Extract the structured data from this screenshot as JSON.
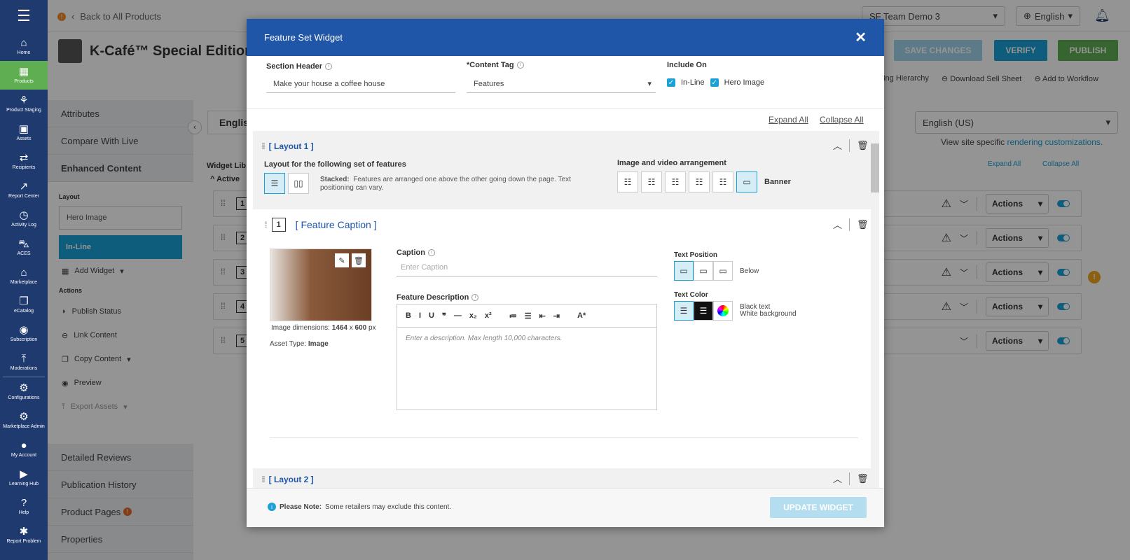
{
  "nav": {
    "items": [
      {
        "icon": "home-icon",
        "glyph": "⌂",
        "label": "Home"
      },
      {
        "icon": "products-icon",
        "glyph": "▦",
        "label": "Products"
      },
      {
        "icon": "product-staging-icon",
        "glyph": "⚘",
        "label": "Product Staging"
      },
      {
        "icon": "assets-icon",
        "glyph": "▣",
        "label": "Assets"
      },
      {
        "icon": "recipients-icon",
        "glyph": "⇄",
        "label": "Recipients"
      },
      {
        "icon": "report-center-icon",
        "glyph": "↗",
        "label": "Report Center"
      },
      {
        "icon": "activity-log-icon",
        "glyph": "◷",
        "label": "Activity Log"
      },
      {
        "icon": "aces-icon",
        "glyph": "⛍",
        "label": "ACES"
      },
      {
        "icon": "marketplace-icon",
        "glyph": "⌂",
        "label": "Marketplace"
      },
      {
        "icon": "ecatalog-icon",
        "glyph": "❒",
        "label": "eCatalog"
      },
      {
        "icon": "subscription-icon",
        "glyph": "◉",
        "label": "Subscription"
      },
      {
        "icon": "moderations-icon",
        "glyph": "⤒",
        "label": "Moderations"
      },
      {
        "icon": "configurations-icon",
        "glyph": "⚙",
        "label": "Configurations"
      },
      {
        "icon": "marketplace-admin-icon",
        "glyph": "⚙",
        "label": "Marketplace Admin"
      },
      {
        "icon": "my-account-icon",
        "glyph": "●",
        "label": "My Account"
      },
      {
        "icon": "learning-hub-icon",
        "glyph": "▶",
        "label": "Learning Hub"
      },
      {
        "icon": "help-icon",
        "glyph": "?",
        "label": "Help"
      },
      {
        "icon": "report-problem-icon",
        "glyph": "✱",
        "label": "Report Problem"
      }
    ]
  },
  "topbar": {
    "back_label": "Back to All Products",
    "org_select": "SF Team Demo 3",
    "language_select": "English"
  },
  "product": {
    "title": "K-Café™ Special Edition",
    "buttons": {
      "save": "SAVE CHANGES",
      "verify": "VERIFY",
      "publish": "PUBLISH"
    },
    "links": {
      "hierarchy": "ging Hierarchy",
      "sell_sheet": "Download Sell Sheet",
      "workflow": "Add to Workflow"
    }
  },
  "side": {
    "tabs_top": [
      "Attributes",
      "Compare With Live",
      "Enhanced Content"
    ],
    "layout_label": "Layout",
    "layout_items": [
      "Hero Image",
      "In-Line"
    ],
    "add_widget": "Add Widget",
    "actions_label": "Actions",
    "actions": [
      "Publish Status",
      "Link Content",
      "Copy Content",
      "Preview",
      "Export Assets"
    ],
    "tabs_bottom": [
      "Detailed Reviews",
      "Publication History",
      "Product Pages",
      "Properties"
    ]
  },
  "main": {
    "lang_tab": "Englis",
    "widget_lib": "Widget Lib",
    "active": "Active",
    "locale_select": "English (US)",
    "rendering_prefix": "View site specific",
    "rendering_link": "rendering customizations.",
    "expand_all": "Expand All",
    "collapse_all": "Collapse All",
    "rows": [
      "1",
      "2",
      "3",
      "4",
      "5"
    ],
    "actions_label": "Actions"
  },
  "modal": {
    "title": "Feature Set Widget",
    "section_header_label": "Section Header",
    "section_header_value": "Make your house a coffee house",
    "content_tag_label": "Content Tag",
    "content_tag_required": "*",
    "content_tag_value": "Features",
    "include_on_label": "Include On",
    "include_inline": "In-Line",
    "include_hero": "Hero Image",
    "expand_all": "Expand All",
    "collapse_all": "Collapse All",
    "layout1": "[ Layout 1 ]",
    "layout_for": "Layout for the following set of features",
    "stacked_label": "Stacked:",
    "stacked_desc": "Features are arranged one above the other going down the page. Text positioning can vary.",
    "img_arrangement": "Image and video arrangement",
    "banner": "Banner",
    "feature_num": "1",
    "feature_caption": "[ Feature Caption ]",
    "caption_label": "Caption",
    "caption_placeholder": "Enter Caption",
    "desc_label": "Feature Description",
    "desc_placeholder": "Enter a description. Max length 10,000 characters.",
    "img_dim_label": "Image dimensions:",
    "img_w": "1464",
    "img_x": "x",
    "img_h": "600",
    "img_unit": "px",
    "asset_type_label": "Asset Type:",
    "asset_type": "Image",
    "text_position_label": "Text Position",
    "text_position_value": "Below",
    "text_color_label": "Text Color",
    "text_color_line1": "Black text",
    "text_color_line2": "White background",
    "layout2": "[ Layout 2 ]",
    "note_bold": "Please Note:",
    "note_text": "Some retailers may exclude this content.",
    "update_btn": "UPDATE WIDGET",
    "toolbar": [
      "B",
      "I",
      "U",
      "❞",
      "—",
      "x₂",
      "x²",
      "≔",
      "☰",
      "⇤",
      "⇥",
      "A*"
    ]
  },
  "colors": {
    "nav": "#1e3a6e",
    "modal_header": "#1f56a8",
    "accent": "#1ba1d6",
    "publish": "#5fae52"
  }
}
